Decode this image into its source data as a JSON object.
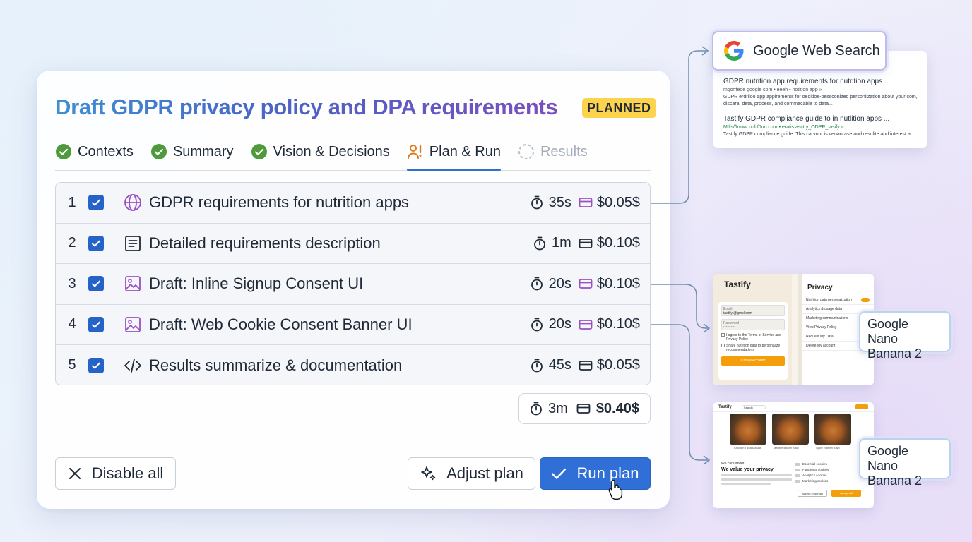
{
  "card": {
    "title": "Draft GDPR privacy policy and DPA requirements",
    "status_badge": "PLANNED"
  },
  "tabs": [
    {
      "label": "Contexts",
      "state": "done",
      "icon": "check-circle-icon"
    },
    {
      "label": "Summary",
      "state": "done",
      "icon": "check-circle-icon"
    },
    {
      "label": "Vision & Decisions",
      "state": "done",
      "icon": "check-circle-icon"
    },
    {
      "label": "Plan & Run",
      "state": "active",
      "icon": "user-run-icon"
    },
    {
      "label": "Results",
      "state": "pending",
      "icon": "dashed-circle-icon"
    }
  ],
  "steps": [
    {
      "num": "1",
      "checked": true,
      "icon": "globe-icon",
      "label": "GDPR requirements for nutrition apps",
      "time": "35s",
      "cost": "$0.05$",
      "cost_icon_color": "#9b4fc4"
    },
    {
      "num": "2",
      "checked": true,
      "icon": "document-icon",
      "label": "Detailed requirements description",
      "time": "1m",
      "cost": "$0.10$",
      "cost_icon_color": "#1f2937"
    },
    {
      "num": "3",
      "checked": true,
      "icon": "image-icon",
      "label": "Draft: Inline Signup Consent UI",
      "time": "20s",
      "cost": "$0.10$",
      "cost_icon_color": "#9b4fc4"
    },
    {
      "num": "4",
      "checked": true,
      "icon": "image-icon",
      "label": "Draft: Web Cookie Consent Banner UI",
      "time": "20s",
      "cost": "$0.10$",
      "cost_icon_color": "#9b4fc4"
    },
    {
      "num": "5",
      "checked": true,
      "icon": "code-icon",
      "label": "Results summarize & documentation",
      "time": "45s",
      "cost": "$0.05$",
      "cost_icon_color": "#1f2937"
    }
  ],
  "total": {
    "time": "3m",
    "cost": "$0.40$"
  },
  "buttons": {
    "disable_all": "Disable all",
    "adjust_plan": "Adjust plan",
    "run_plan": "Run plan"
  },
  "tools": {
    "search": {
      "label": "Google Web Search",
      "results": [
        {
          "title": "GDPR nutrition app requirements for nutrition apps ...",
          "url": "mgo#feoe google com  • eeeh  • notition app  »",
          "desc": "GDPR erdriioo app appirements for oeditioe-pessconized personlization about your com, discara, deta, process, and commecable to data..."
        },
        {
          "title": "Tastify GDPR compliance guide to in nutlition apps ...",
          "url": "Miljs//fmwv nubf0oo com  • eratis asctty_ODPR_tasify  »",
          "desc": "Tastify GDPR compliance guide. This carvonr is venanrase and resulite and interest at"
        }
      ]
    },
    "nano_1": {
      "label": "Google Nano Banana 2"
    },
    "nano_2": {
      "label": "Google Nano Banana 2"
    }
  },
  "mockup_signup": {
    "brand": "Tastify",
    "panel_title": "Privacy",
    "email_label": "Email",
    "email_value": "tastifyl@gmcl.com",
    "password_label": "Password",
    "password_value": "•••••••••",
    "check_1": "I agree to the Terms of Service and Privacy Policy",
    "check_2": "Share nutrition data to personalize recommendations",
    "cta": "Create Account",
    "settings": [
      "Nutrition data personalization",
      "Analytics & usage data",
      "Marketing communications",
      "View Privacy Policy",
      "Request My Data",
      "Delete My account"
    ]
  },
  "mockup_cookie": {
    "brand": "Tastify",
    "search_placeholder": "Search",
    "heading_small": "We care about...",
    "heading": "We value your privacy",
    "options": [
      "Essential cookies",
      "Functional cookies",
      "Analytics cookies",
      "Marketing cookies"
    ],
    "btn_reject": "Accept Essential",
    "btn_accept": "Accept All",
    "captions": [
      "Chicken Tikka Masala",
      "Mediterranean Bowl",
      "Spicy Ramen Bowl"
    ]
  }
}
